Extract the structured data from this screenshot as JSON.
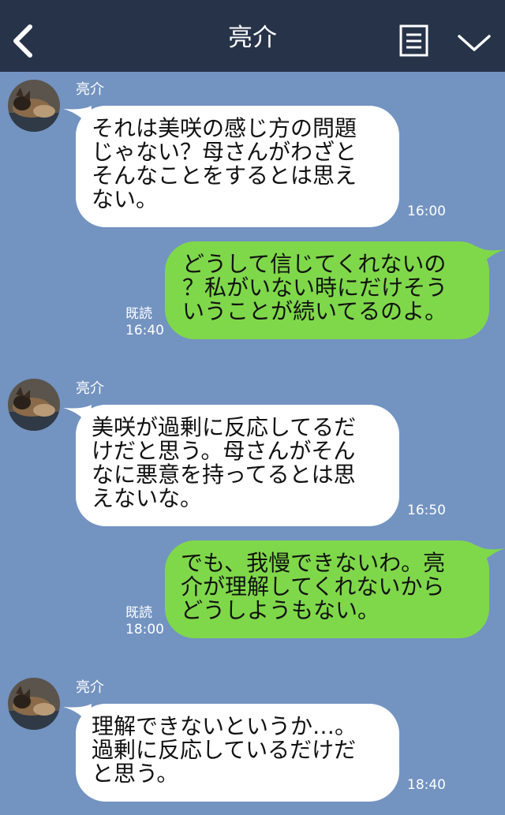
{
  "header": {
    "title": "亮介",
    "back_icon": "chevron-left-icon",
    "menu_icon": "document-menu-icon",
    "expand_icon": "chevron-down-icon"
  },
  "colors": {
    "header_bg": "#263348",
    "chat_bg": "#7393c1",
    "incoming_bubble": "#ffffff",
    "outgoing_bubble": "#7fd84a"
  },
  "messages": [
    {
      "direction": "in",
      "sender": "亮介",
      "text": "それは美咲の感じ方の問題\nじゃない？母さんがわざと\nそんなことをするとは思え\nない。",
      "time": "16:00"
    },
    {
      "direction": "out",
      "text": "どうして信じてくれないの\n？私がいない時にだけそう\nいうことが続いてるのよ。",
      "read": "既読",
      "time": "16:40"
    },
    {
      "direction": "in",
      "sender": "亮介",
      "text": "美咲が過剰に反応してるだ\nけだと思う。母さんがそん\nなに悪意を持ってるとは思\nえないな。",
      "time": "16:50"
    },
    {
      "direction": "out",
      "text": "でも、我慢できないわ。亮\n介が理解してくれないから\nどうしようもない。",
      "read": "既読",
      "time": "18:00"
    },
    {
      "direction": "in",
      "sender": "亮介",
      "text": "理解できないというか…。\n過剰に反応しているだけだ\nと思う。",
      "time": "18:40"
    }
  ]
}
